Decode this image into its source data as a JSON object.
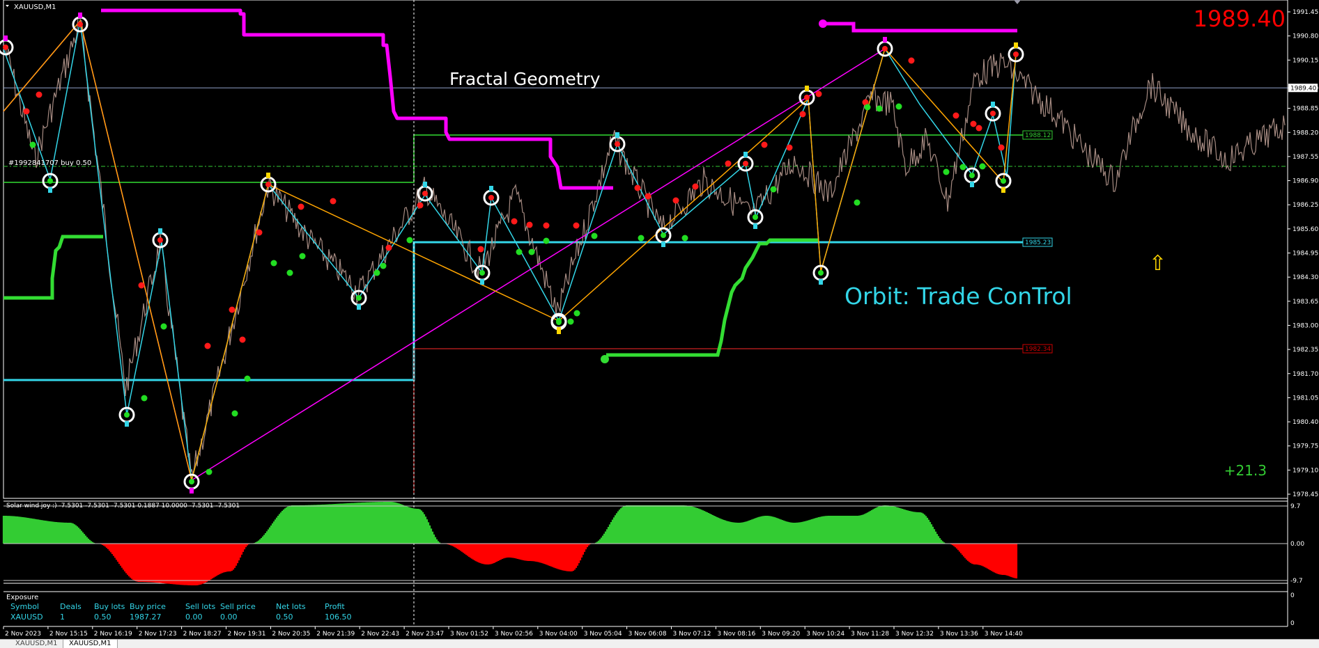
{
  "window": {
    "symbol_title": "XAUUSD,M1"
  },
  "price_display": {
    "current": "1989.40",
    "current_color": "#ff0000",
    "pips": "+21.3",
    "pips_color": "#33cc33"
  },
  "annotations": {
    "title": "Fractal Geometry",
    "brand": "Orbit: Trade ConTrol",
    "brand_color": "#33d6e8",
    "line_label": "#1992841707 buy 0.50",
    "up_arrow": "⇧"
  },
  "price_axis": {
    "ticks": [
      "1991.45",
      "1990.80",
      "1990.15",
      "1989.40",
      "1988.85",
      "1988.20",
      "1987.55",
      "1986.90",
      "1986.25",
      "1985.60",
      "1984.95",
      "1984.30",
      "1983.65",
      "1983.00",
      "1982.35",
      "1981.70",
      "1981.05",
      "1980.40",
      "1979.75",
      "1979.10",
      "1978.45"
    ],
    "levels": [
      {
        "label": "1988.12",
        "color": "#33cc33"
      },
      {
        "label": "1985.23",
        "color": "#33d6e8"
      },
      {
        "label": "1982.34",
        "color": "#cc0000"
      }
    ]
  },
  "time_axis": {
    "ticks": [
      "2 Nov 2023",
      "2 Nov 15:15",
      "2 Nov 16:19",
      "2 Nov 17:23",
      "2 Nov 18:27",
      "2 Nov 19:31",
      "2 Nov 20:35",
      "2 Nov 21:39",
      "2 Nov 22:43",
      "2 Nov 23:47",
      "3 Nov 01:52",
      "3 Nov 02:56",
      "3 Nov 04:00",
      "3 Nov 05:04",
      "3 Nov 06:08",
      "3 Nov 07:12",
      "3 Nov 08:16",
      "3 Nov 09:20",
      "3 Nov 10:24",
      "3 Nov 11:28",
      "3 Nov 12:32",
      "3 Nov 13:36",
      "3 Nov 14:40"
    ]
  },
  "indicator": {
    "title": "Solar wind joy :) -7.5301 -7.5301 -7.5301 0.1887 10.0000 -7.5301 -7.5301",
    "top_label": "9.7",
    "zero_label": "0.00",
    "bottom_label": "-9.7",
    "up_color": "#33cc33",
    "down_color": "#ff0000"
  },
  "exposure": {
    "title": "Exposure",
    "headers": [
      "Symbol",
      "Deals",
      "Buy lots",
      "Buy price",
      "Sell lots",
      "Sell price",
      "Net lots",
      "Profit"
    ],
    "row": [
      "XAUUSD",
      "1",
      "0.50",
      "1987.27",
      "0.00",
      "0.00",
      "0.50",
      "106.50"
    ],
    "axis_top": "0",
    "axis_bottom": "0",
    "header_color": "#33d6e8"
  },
  "tabs": [
    "XAUUSD,M1",
    "XAUUSD,M1"
  ],
  "colors": {
    "background": "#000000",
    "magenta": "#ff00ff",
    "green": "#33dd33",
    "cyan": "#33d6e8",
    "orange": "#ffa500",
    "red": "#ff0000",
    "candles": "#b89a90"
  }
}
